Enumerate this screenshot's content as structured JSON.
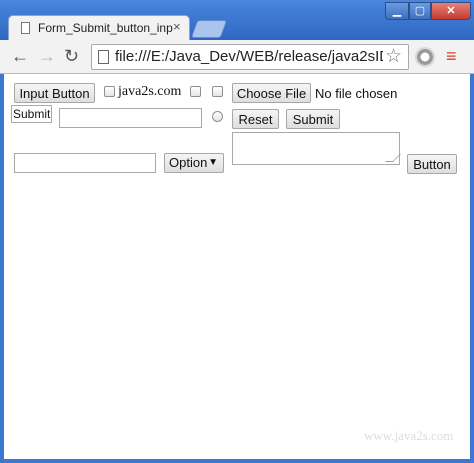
{
  "window": {
    "tab_title": "Form_Submit_button_inp",
    "tab_close": "×",
    "controls": {
      "minimize": "▁",
      "maximize": "▢",
      "close": "✕"
    }
  },
  "toolbar": {
    "back_icon": "←",
    "forward_icon": "→",
    "reload_icon": "↻",
    "url": "file:///E:/Java_Dev/WEB/release/java2sIDE",
    "star_icon": "☆",
    "menu_icon": "≡"
  },
  "form": {
    "input_button": "Input Button",
    "checkbox_label": "java2s.com",
    "choose_file": "Choose File",
    "no_file": "No file chosen",
    "submit_image_alt": "Submit",
    "text_value": "",
    "reset": "Reset",
    "submit": "Submit",
    "text2_value": "",
    "select_option": "Option",
    "select_arrow": "▼",
    "button": "Button"
  },
  "watermark": "www.java2s.com"
}
